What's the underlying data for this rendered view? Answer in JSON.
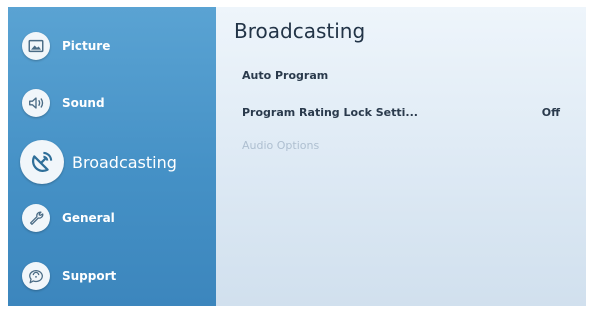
{
  "sidebar": {
    "items": [
      {
        "label": "Picture",
        "icon": "picture-icon"
      },
      {
        "label": "Sound",
        "icon": "sound-icon"
      },
      {
        "label": "Broadcasting",
        "icon": "broadcasting-icon",
        "active": true
      },
      {
        "label": "General",
        "icon": "wrench-icon"
      },
      {
        "label": "Support",
        "icon": "support-icon"
      }
    ]
  },
  "main": {
    "title": "Broadcasting",
    "menu": [
      {
        "label": "Auto Program",
        "value": ""
      },
      {
        "label": "Program Rating Lock Setti...",
        "value": "Off"
      },
      {
        "label": "Audio Options",
        "value": "",
        "disabled": true
      }
    ]
  },
  "colors": {
    "sidebar": "#4591c6",
    "content_bg": "#e3edf6",
    "text": "#2a3a4c",
    "disabled_text": "#aebfd0"
  }
}
